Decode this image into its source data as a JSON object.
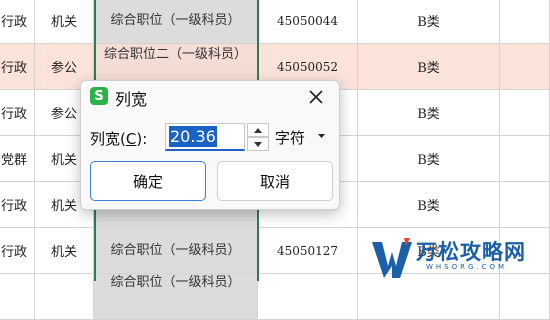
{
  "sheet": {
    "rows": [
      {
        "type": "行政",
        "cat": "机关",
        "position": "综合职位（一级科员）",
        "code": "45050044",
        "class": "B类"
      },
      {
        "type": "行政",
        "cat": "参公",
        "position": "综合职位二（一级科员）",
        "code": "45050052",
        "class": "B类"
      },
      {
        "type": "行政",
        "cat": "参公",
        "position": "",
        "code": "",
        "class": "B类"
      },
      {
        "type": "党群",
        "cat": "机关",
        "position": "",
        "code": "",
        "class": "B类"
      },
      {
        "type": "行政",
        "cat": "机关",
        "position": "",
        "code": "",
        "class": "B类"
      },
      {
        "type": "行政",
        "cat": "机关",
        "position": "综合职位（一级科员）",
        "code": "45050127",
        "class": "B类"
      },
      {
        "type": "",
        "cat": "",
        "position": "综合职位（一级科员）",
        "code": "",
        "class": ""
      }
    ]
  },
  "dialog": {
    "logo": "S",
    "title": "列宽",
    "label_prefix": "列宽(",
    "label_key": "C",
    "label_suffix": "):",
    "value": "20.36",
    "unit": "字符",
    "ok_label": "确定",
    "cancel_label": "取消"
  },
  "watermark": {
    "text": "万松攻略网",
    "sub": "WHSORG.COM"
  },
  "colors": {
    "highlight_row": "#fbe3da",
    "selected_column": "#dcdcdc",
    "selection_border": "#2e7d4f",
    "input_selection": "#1a62c4",
    "logo": "#2db24a"
  }
}
